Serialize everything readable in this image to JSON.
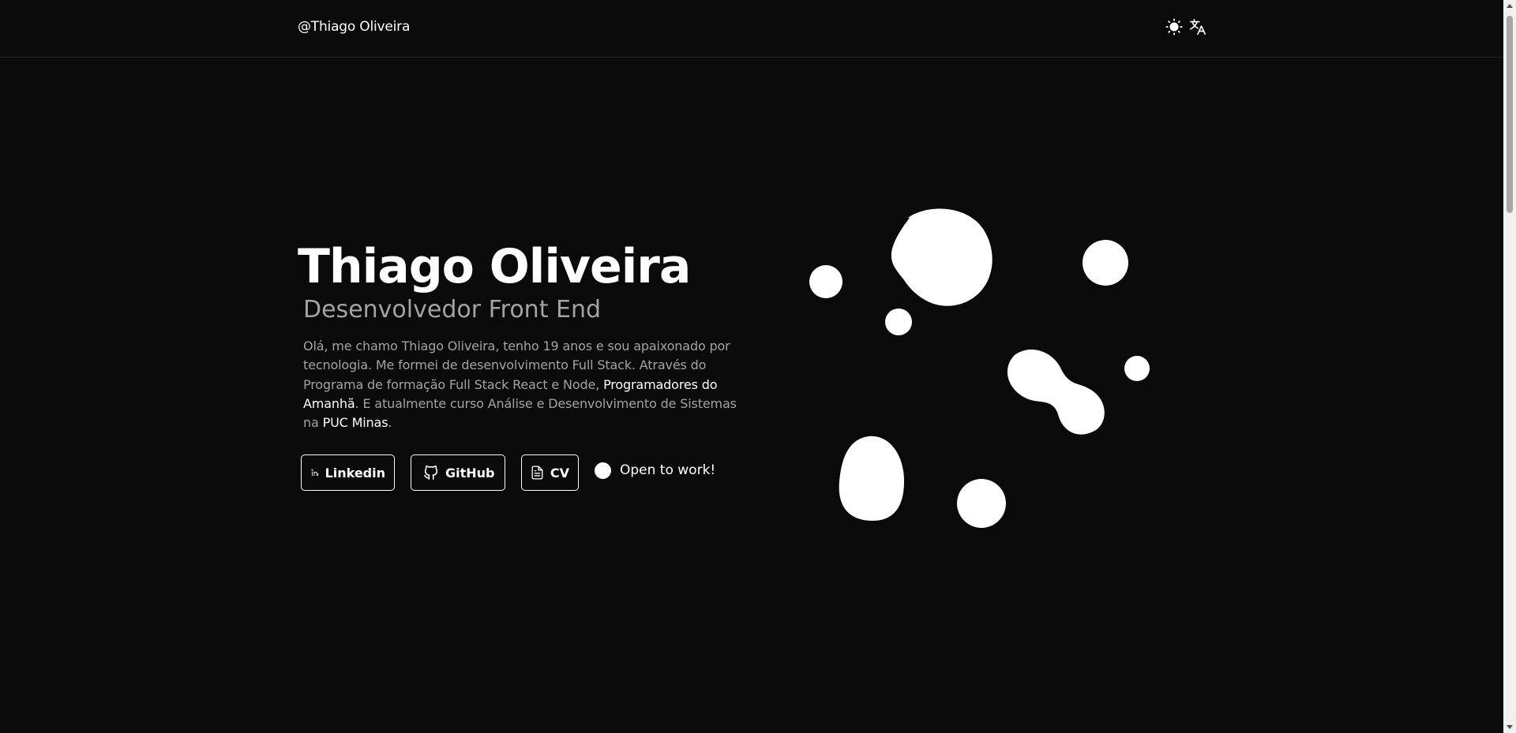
{
  "header": {
    "brand": "@Thiago Oliveira",
    "theme_icon": "sun-icon",
    "language_icon": "translate-icon"
  },
  "hero": {
    "name": "Thiago Oliveira",
    "role": "Desenvolvedor Front End",
    "bio": {
      "part1": "Olá, me chamo Thiago Oliveira, tenho 19 anos e sou apaixonado por tecnologia. Me formei de desenvolvimento Full Stack. Através do Programa de formação Full Stack React e Node, ",
      "link1": "Programadores do Amanhã",
      "part2": ". E atualmente curso Análise e Desenvolvimento de Sistemas na ",
      "link2": "PUC Minas",
      "part3": "."
    }
  },
  "actions": {
    "linkedin_label": "Linkedin",
    "github_label": "GitHub",
    "cv_label": "CV",
    "status_label": "Open to work!"
  },
  "colors": {
    "background": "#0a0a0a",
    "text": "#ffffff",
    "muted": "#a3a3a3",
    "border": "#262626"
  }
}
